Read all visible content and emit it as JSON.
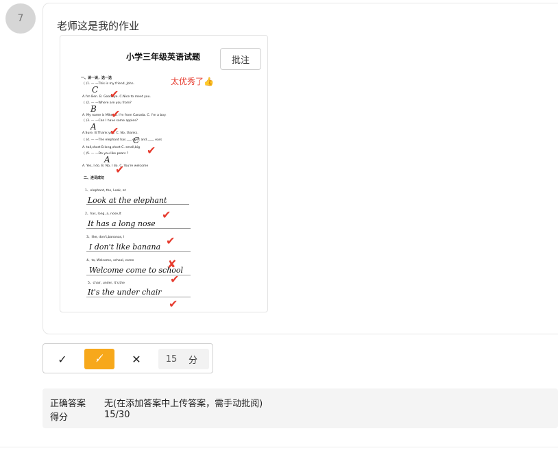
{
  "question": {
    "number": "7"
  },
  "student": {
    "answer_text": "老师这是我的作业"
  },
  "worksheet": {
    "annotate_label": "批注",
    "title": "小学三年级英语试题",
    "praise": "太优秀了",
    "praise_icon": "thumbs-up-icon",
    "section1": "一、读一读，选一选",
    "lines": [
      "( )1. — —This is my friend, John.",
      "A.I'm Ben.   B. Goodbye.   C.Nice to meet you.",
      "( )2. — —Where are you from?",
      "A. My name is Mike.   B. I'm from Canada.   C. I'm a boy.",
      "( )3. — —Can I have some apples?",
      "A.Sure.   B.Thank you.   C. No, thanks.",
      "( )4. — —The elephant has ___ eyes and ____ ears",
      "A. tall,short   B.long,short   C. small,big",
      "( )5. — —Do you like pears ?",
      "A. Yes, I do.   B. No, I do.   C. You're welcome"
    ],
    "handwritten_letters": [
      "C",
      "B",
      "A",
      "C",
      "A"
    ],
    "section2": "二、连词成句",
    "prompts": [
      "1、elephant, the, Look, at",
      "2、has, long, a, nose,It",
      "3、like, don't,bananas, I",
      "4、to, Welcome, school, come",
      "5、chair, under, it's,the"
    ],
    "answers": [
      "Look at the elephant",
      "It has a long nose",
      "I don't like banana",
      "Welcome come to school",
      "It's the under chair"
    ]
  },
  "grading": {
    "score_value": "15",
    "score_unit": "分",
    "correct_icon": "check-icon",
    "partial_icon": "half-check-icon",
    "wrong_icon": "close-icon"
  },
  "result": {
    "correct_answer_label": "正确答案",
    "correct_answer_value": "无(在添加答案中上传答案，需手动批阅)",
    "score_label": "得分",
    "score_value": "15/30"
  }
}
